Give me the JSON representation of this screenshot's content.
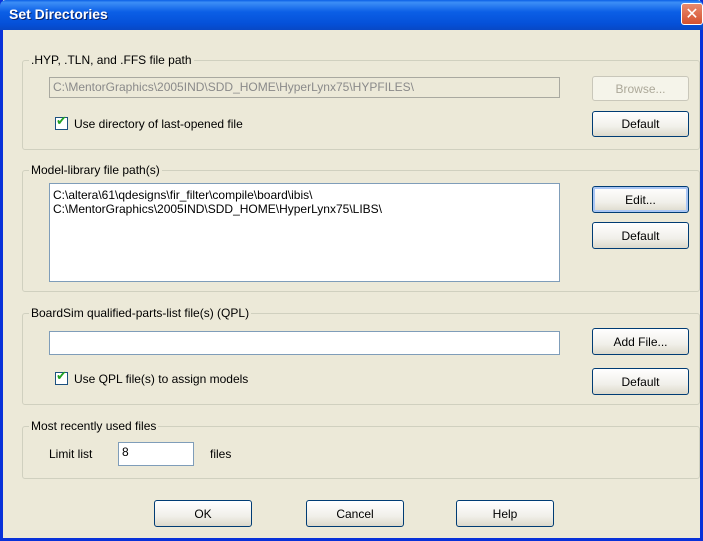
{
  "window": {
    "title": "Set Directories",
    "close_glyph": "✕"
  },
  "hyp_group": {
    "legend": ".HYP, .TLN, and .FFS file path",
    "path_value": "C:\\MentorGraphics\\2005IND\\SDD_HOME\\HyperLynx75\\HYPFILES\\",
    "browse_label": "Browse...",
    "use_last_dir_label": "Use directory of last-opened file",
    "use_last_dir_checked": true,
    "default_label": "Default"
  },
  "model_group": {
    "legend": "Model-library file path(s)",
    "paths": [
      "C:\\altera\\61\\qdesigns\\fir_filter\\compile\\board\\ibis\\",
      "C:\\MentorGraphics\\2005IND\\SDD_HOME\\HyperLynx75\\LIBS\\"
    ],
    "edit_label": "Edit...",
    "default_label": "Default"
  },
  "qpl_group": {
    "legend": "BoardSim qualified-parts-list file(s) (QPL)",
    "file_value": "",
    "add_file_label": "Add File...",
    "use_qpl_label": "Use QPL file(s) to assign models",
    "use_qpl_checked": true,
    "default_label": "Default"
  },
  "mru_group": {
    "legend": "Most recently used files",
    "limit_label": "Limit list",
    "limit_value": "8",
    "files_label": "files"
  },
  "footer": {
    "ok_label": "OK",
    "cancel_label": "Cancel",
    "help_label": "Help"
  },
  "icons": {
    "close": "close-icon",
    "check": "checkmark-icon"
  }
}
